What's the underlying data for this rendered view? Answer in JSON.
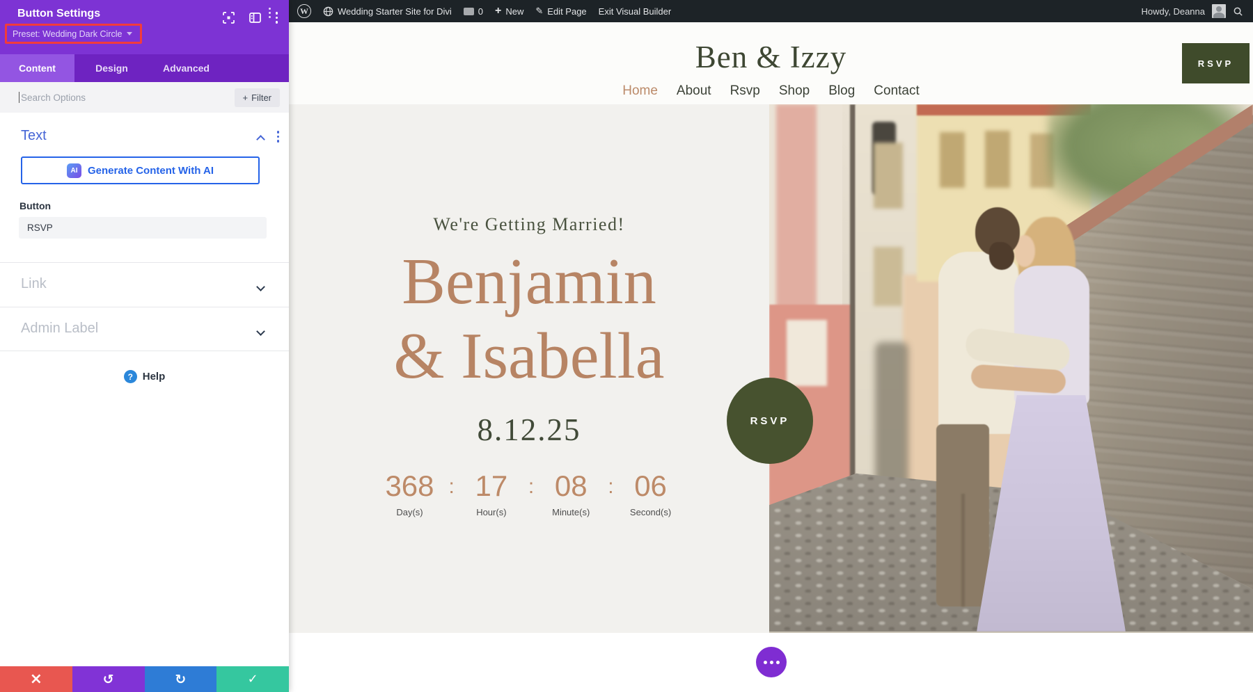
{
  "admin_bar": {
    "wp_logo_letter": "W",
    "site_name": "Wedding Starter Site for Divi",
    "comments_count": "0",
    "plus": "+",
    "new_label": "New",
    "edit_icon_glyph": "✎",
    "edit_page_label": "Edit Page",
    "exit_label": "Exit Visual Builder",
    "howdy": "Howdy, Deanna"
  },
  "panel": {
    "title": "Button Settings",
    "preset": "Preset: Wedding Dark Circle",
    "tabs": [
      {
        "label": "Content"
      },
      {
        "label": "Design"
      },
      {
        "label": "Advanced"
      }
    ],
    "search_placeholder": "Search Options",
    "filter_plus": "+",
    "filter_label": "Filter",
    "text_section": {
      "title": "Text",
      "ai_badge": "AI",
      "ai_button_label": "Generate Content With AI",
      "button_field_label": "Button",
      "button_field_value": "RSVP"
    },
    "link_section_title": "Link",
    "admin_label_section_title": "Admin Label",
    "help_icon": "?",
    "help_label": "Help",
    "footer": {
      "close": "×",
      "undo": "↺",
      "redo": "↻",
      "save": "✓"
    }
  },
  "site": {
    "logo": "Ben & Izzy",
    "nav": [
      {
        "label": "Home"
      },
      {
        "label": "About"
      },
      {
        "label": "Rsvp"
      },
      {
        "label": "Shop"
      },
      {
        "label": "Blog"
      },
      {
        "label": "Contact"
      }
    ],
    "header_rsvp_label": "RSVP",
    "hero": {
      "eyebrow": "We're Getting Married!",
      "title_line1": "Benjamin",
      "title_line2": "& Isabella",
      "date": "8.12.25",
      "colon": ":",
      "countdown": [
        {
          "value": "368",
          "label": "Day(s)"
        },
        {
          "value": "17",
          "label": "Hour(s)"
        },
        {
          "value": "08",
          "label": "Minute(s)"
        },
        {
          "value": "06",
          "label": "Second(s)"
        }
      ],
      "rsvp_circle_label": "RSVP"
    }
  },
  "colors": {
    "builder_purple": "#7d33d4",
    "builder_tab_purple": "#6e23c1",
    "active_tab_purple": "#9355e2",
    "preset_highlight_red": "#f23b3b",
    "olive_green": "#47522f",
    "terracotta": "#b78464",
    "admin_bar_dark": "#1d2327",
    "ai_blue": "#2563e8",
    "help_blue": "#2b87da",
    "footer_red": "#e85750",
    "footer_purple": "#8133d6",
    "footer_blue": "#2e7cd6",
    "footer_green": "#35c79f"
  }
}
